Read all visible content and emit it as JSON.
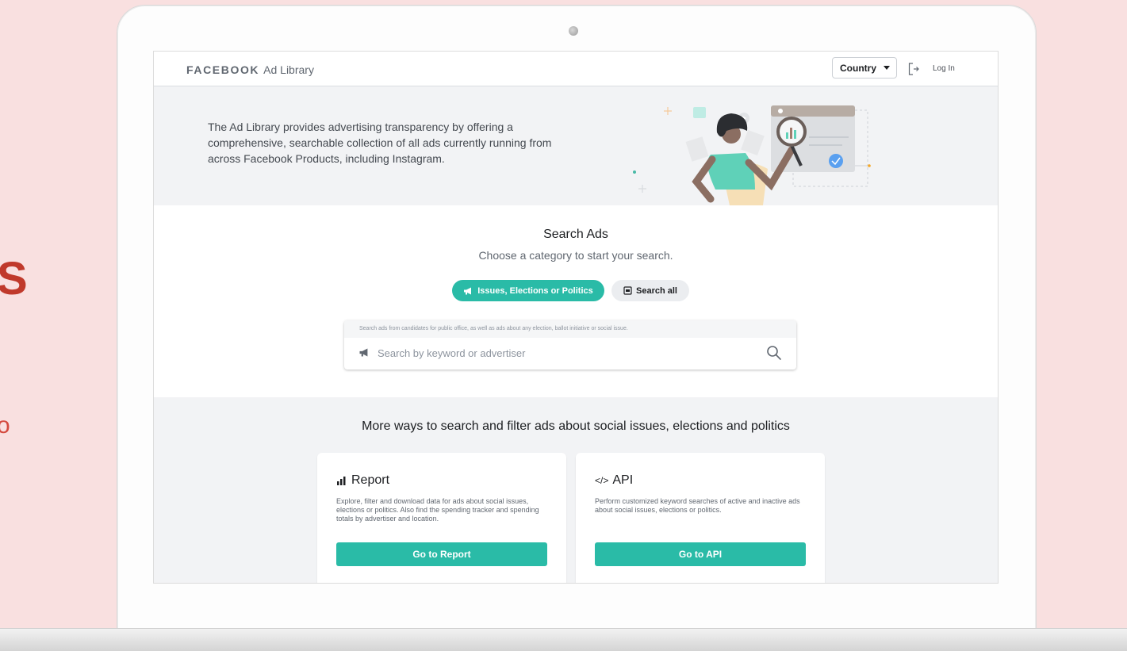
{
  "edge_letters": {
    "first": "S",
    "second": "o"
  },
  "header": {
    "brand_facebook": "FACEBOOK",
    "brand_ad_library": "Ad Library",
    "country_label": "Country",
    "login_label": "Log In"
  },
  "hero": {
    "text": "The Ad Library provides advertising transparency by offering a comprehensive, searchable collection of all ads currently running from across Facebook Products, including Instagram."
  },
  "search": {
    "title": "Search Ads",
    "subtitle": "Choose a category to start your search.",
    "categories": [
      {
        "label": "Issues, Elections or Politics",
        "icon": "megaphone-icon",
        "active": true
      },
      {
        "label": "Search all",
        "icon": "ad-box-icon",
        "active": false
      }
    ],
    "hint": "Search ads from candidates for public office, as well as ads about any election, ballot initiative or social issue.",
    "placeholder": "Search by keyword or advertiser"
  },
  "more": {
    "title": "More ways to search and filter ads about social issues, elections and politics",
    "cards": [
      {
        "icon": "bar-chart-icon",
        "title": "Report",
        "description": "Explore, filter and download data for ads about social issues, elections or politics. Also find the spending tracker and spending totals by advertiser and location.",
        "button": "Go to Report"
      },
      {
        "icon": "code-icon",
        "icon_text": "</>",
        "title": "API",
        "description": "Perform customized keyword searches of active and inactive ads about social issues, elections or politics.",
        "button": "Go to API"
      }
    ]
  },
  "colors": {
    "accent": "#2abba7",
    "background": "#f9e0e0",
    "hero_bg": "#f2f3f5"
  }
}
